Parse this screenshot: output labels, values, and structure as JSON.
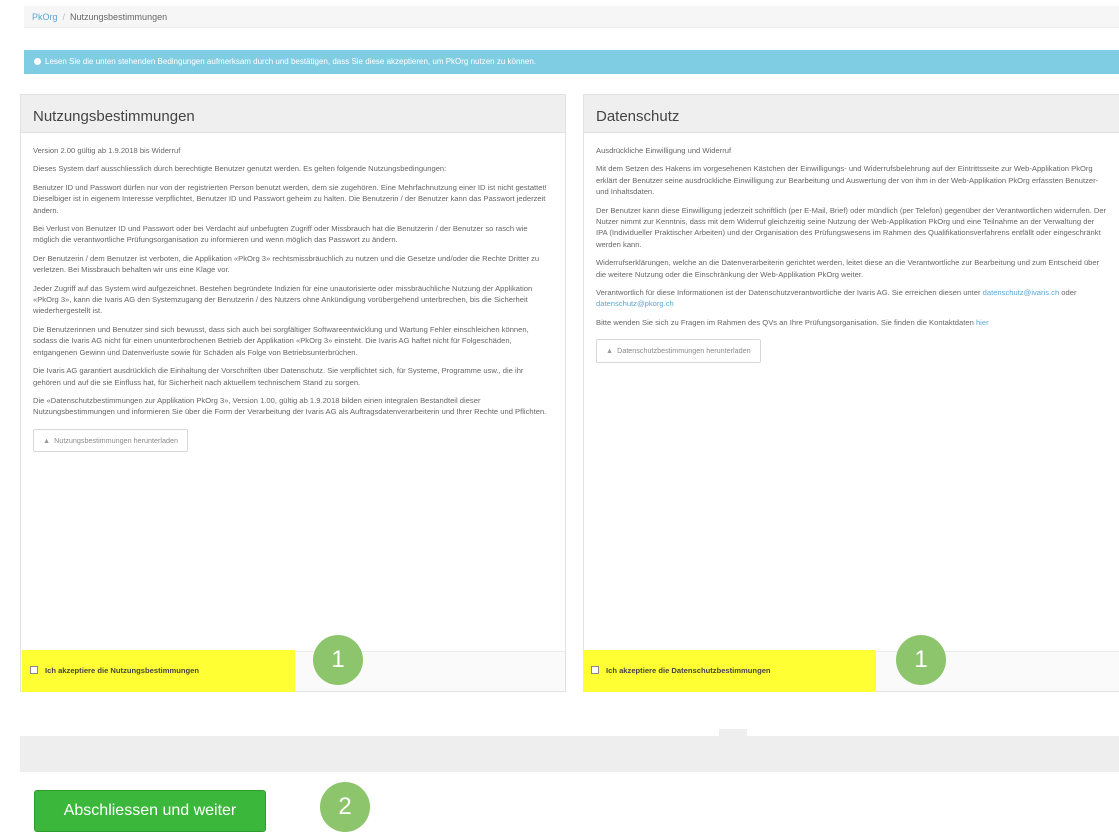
{
  "breadcrumb": {
    "home": "PkOrg",
    "separator": "/",
    "current": "Nutzungsbestimmungen"
  },
  "info_alert": {
    "text": "Lesen Sie die unten stehenden Bedingungen aufmerksam durch und bestätigen, dass Sie diese akzeptieren, um PkOrg nutzen zu können."
  },
  "terms_panel": {
    "title": "Nutzungsbestimmungen",
    "paragraphs": [
      "Version 2.00 gültig ab 1.9.2018 bis Widerruf",
      "Dieses System darf ausschliesslich durch berechtigte Benutzer genutzt werden. Es gelten folgende Nutzungsbedingungen:",
      "Benutzer ID und Passwort dürfen nur von der registrierten Person benutzt werden, dem sie zugehören. Eine Mehrfachnutzung einer ID ist nicht gestattet! Dieselbiger ist in eigenem Interesse verpflichtet, Benutzer ID und Passwort geheim zu halten. Die Benutzerin / der Benutzer kann das Passwort jederzeit ändern.",
      "Bei Verlust von Benutzer ID und Passwort oder bei Verdacht auf unbefugten Zugriff oder Missbrauch hat die Benutzerin / der Benutzer so rasch wie möglich die verantwortliche Prüfungsorganisation zu informieren und wenn möglich das Passwort zu ändern.",
      "Der Benutzerin / dem Benutzer ist verboten, die Applikation «PkOrg 3» rechtsmissbräuchlich zu nutzen und die Gesetze und/oder die Rechte Dritter zu verletzen. Bei Missbrauch behalten wir uns eine Klage vor.",
      "Jeder Zugriff auf das System wird aufgezeichnet. Bestehen begründete Indizien für eine unautorisierte oder missbräuchliche Nutzung der Applikation «PkOrg 3», kann die Ivaris AG den Systemzugang der Benutzerin / des Nutzers ohne Ankündigung vorübergehend unterbrechen, bis die Sicherheit wiederhergestellt ist.",
      "Die Benutzerinnen und Benutzer sind sich bewusst, dass sich auch bei sorgfältiger Softwareentwicklung und Wartung Fehler einschleichen können, sodass die Ivaris AG nicht für einen ununterbrochenen Betrieb der Applikation «PkOrg 3» einsteht. Die Ivaris AG haftet nicht für Folgeschäden, entgangenen Gewinn und Datenverluste sowie für Schäden als Folge von Betriebsunterbrüchen.",
      "Die Ivaris AG garantiert ausdrücklich die Einhaltung der Vorschriften über Datenschutz. Sie verpflichtet sich, für Systeme, Programme usw., die ihr gehören und auf die sie Einfluss hat, für Sicherheit nach aktuellem technischem Stand zu sorgen.",
      "Die «Datenschutzbestimmungen zur Applikation PkOrg 3», Version 1.00, gültig ab 1.9.2018 bilden einen integralen Bestandteil dieser Nutzungsbestimmungen und informieren Sie über die Form der Verarbeitung der Ivaris AG als Auftragsdatenverarbeiterin und Ihrer Rechte und Pflichten."
    ],
    "download_label": "Nutzungsbestimmungen herunterladen",
    "accept_label": "Ich akzeptiere die Nutzungsbestimmungen"
  },
  "privacy_panel": {
    "title": "Datenschutz",
    "paragraphs": [
      "Ausdrückliche Einwilligung und Widerruf",
      "Mit dem Setzen des Hakens im vorgesehenen Kästchen der Einwilligungs- und Widerrufsbelehrung auf der Eintrittsseite zur Web-Applikation PkOrg erklärt der Benutzer seine ausdrückliche Einwilligung zur Bearbeitung und Auswertung der von ihm in der Web-Applikation PkOrg erfassten Benutzer- und Inhaltsdaten.",
      "Der Benutzer kann diese Einwilligung jederzeit schriftlich (per E-Mail, Brief) oder mündlich (per Telefon) gegenüber der Verantwortlichen widerrufen. Der Nutzer nimmt zur Kenntnis, dass mit dem Widerruf gleichzeitig seine Nutzung der Web-Applikation PkOrg und eine Teilnahme an der Verwaltung der IPA (Individueller Praktischer Arbeiten) und der Organisation des Prüfungswesens im Rahmen des Qualifikationsverfahrens entfällt oder eingeschränkt werden kann.",
      "Widerrufserklärungen, welche an die Datenverarbeiterin gerichtet werden, leitet diese an die Verantwortliche zur Bearbeitung und zum Entscheid über die weitere Nutzung oder die Einschränkung der Web-Applikation PkOrg weiter."
    ],
    "contact_prefix": "Verantwortlich für diese Informationen ist der Datenschutzverantwortliche der Ivaris AG. Sie erreichen diesen unter",
    "contact_email_1": "datenschutz@ivaris.ch",
    "contact_or": "oder",
    "contact_email_2": "datenschutz@pkorg.ch",
    "questions_prefix": "Bitte wenden Sie sich zu Fragen im Rahmen des QVs an Ihre Prüfungsorganisation. Sie finden die Kontaktdaten",
    "questions_link": "hier",
    "download_label": "Datenschutzbestimmungen herunterladen",
    "accept_label": "Ich akzeptiere die Datenschutzbestimmungen"
  },
  "step_badges": {
    "first": "1",
    "second": "2"
  },
  "footer": {
    "finish_label": "Abschliessen und weiter"
  },
  "colors": {
    "info": "#7fcde3",
    "highlight": "#ffff33",
    "badge": "#8cc56b",
    "primary_button": "#3bb83b",
    "link": "#5aa7d6"
  },
  "icons": {
    "download": "download-icon",
    "info": "info-icon"
  }
}
